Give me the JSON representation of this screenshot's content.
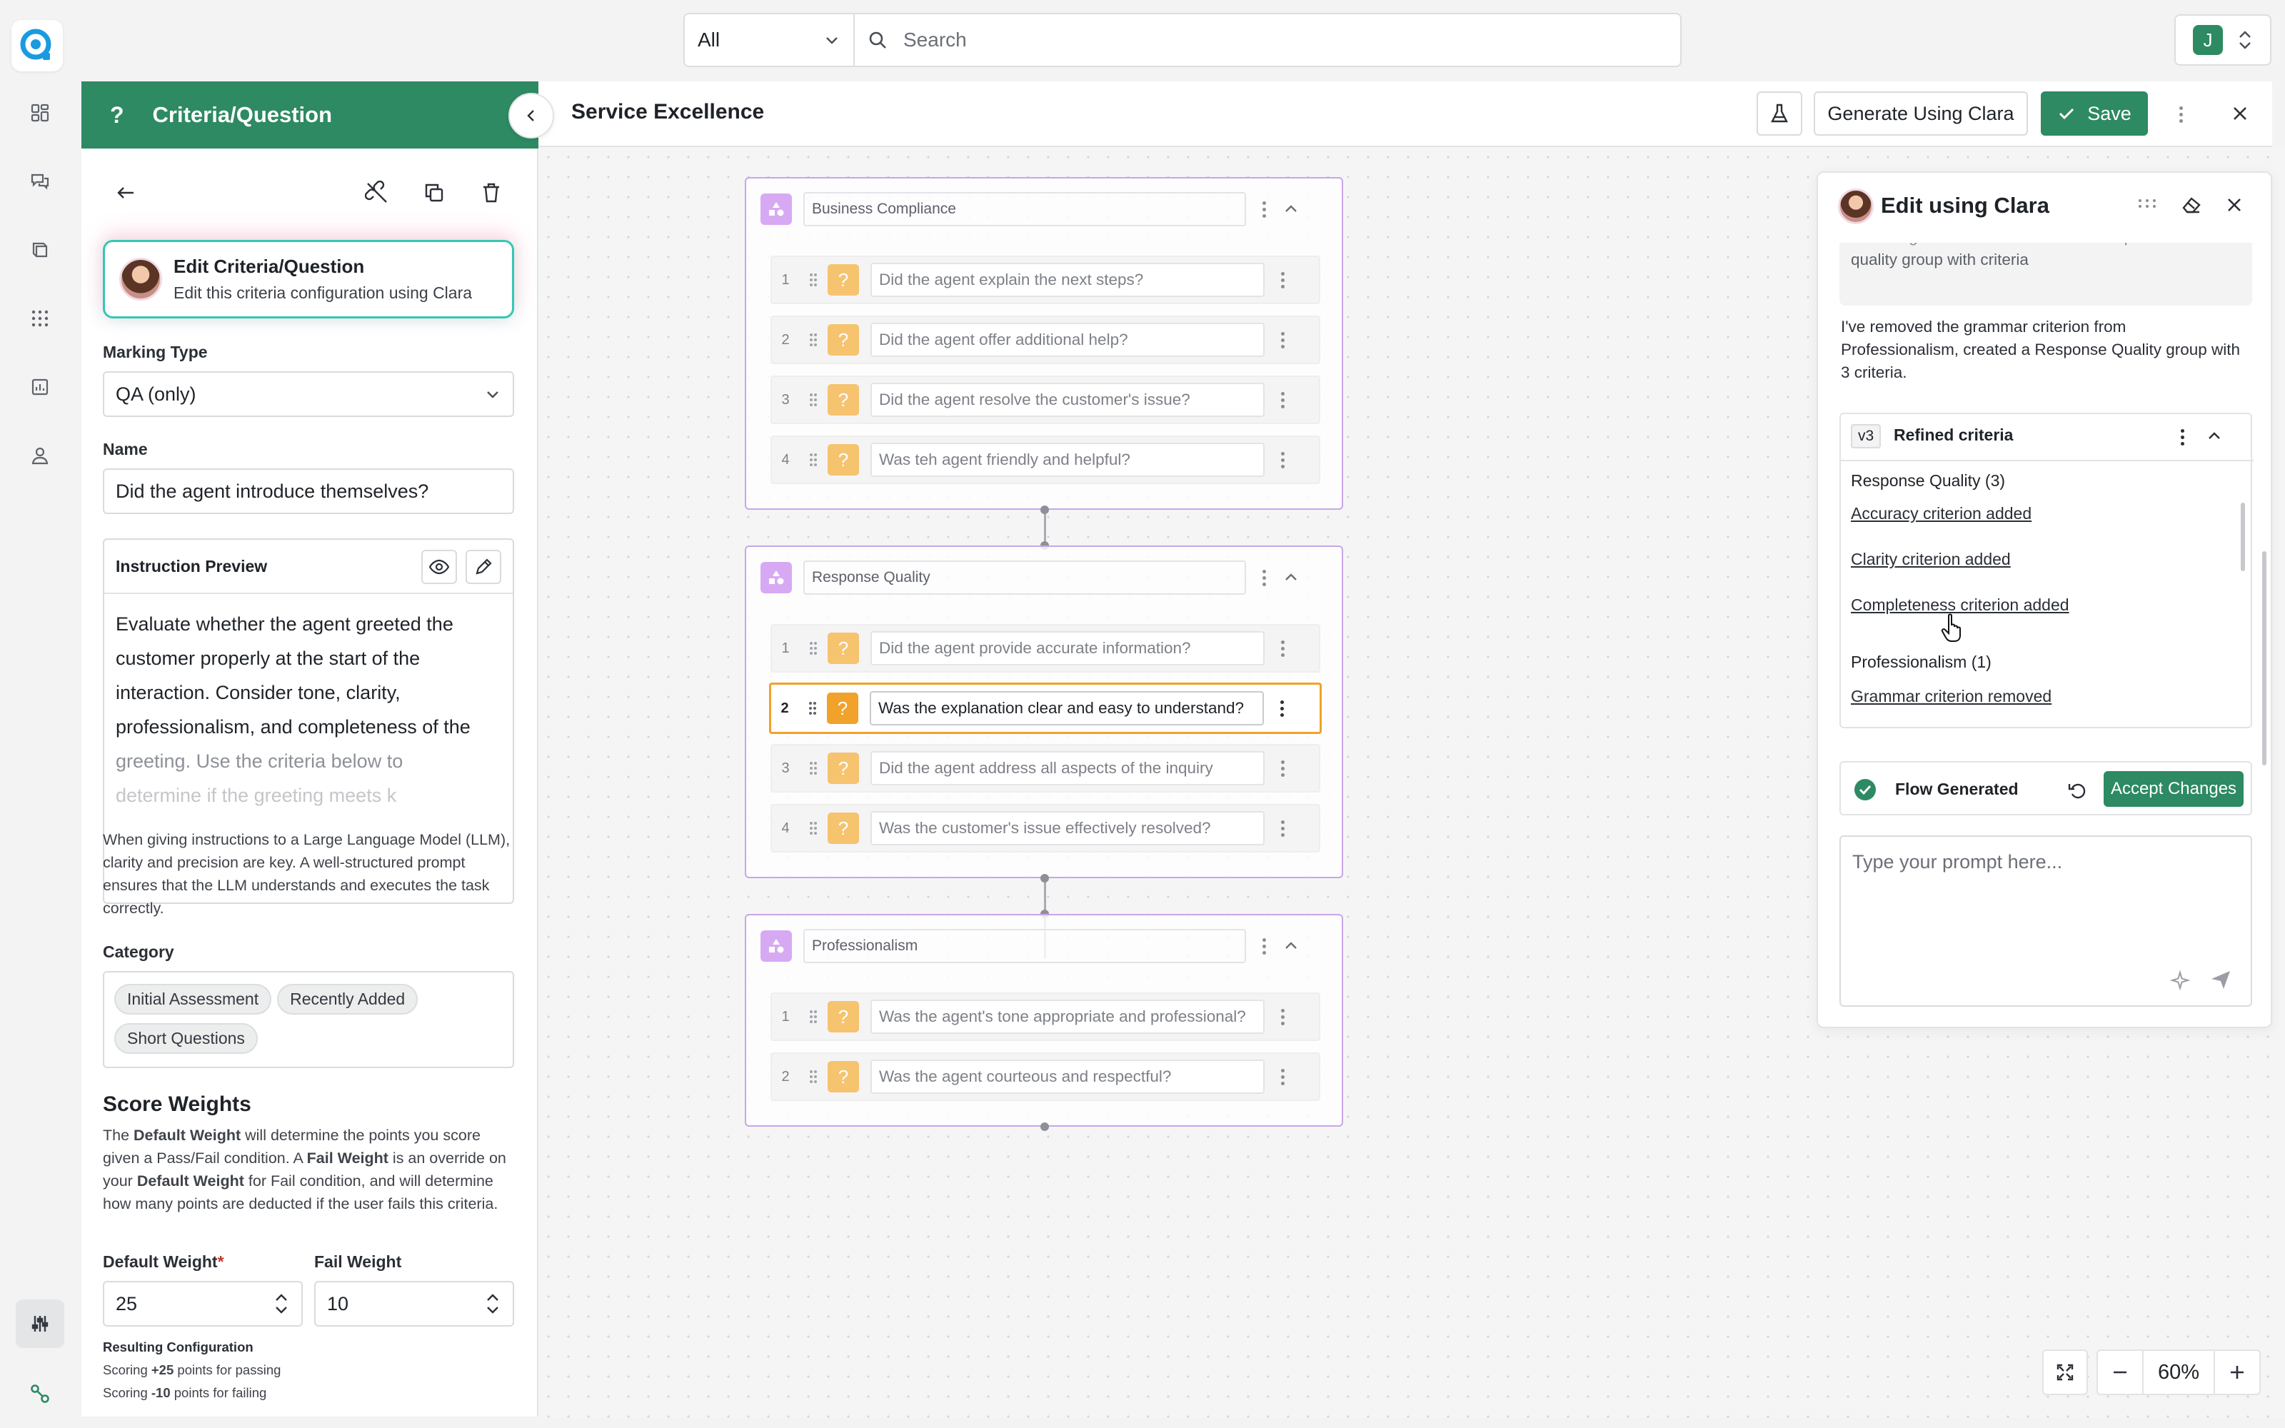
{
  "topbar": {
    "scope_select": "All",
    "search_placeholder": "Search",
    "user_initial": "J"
  },
  "criteria_panel": {
    "header_title": "Criteria/Question",
    "clara_card": {
      "title": "Edit Criteria/Question",
      "subtitle": "Edit this criteria configuration using Clara"
    },
    "marking_type_label": "Marking Type",
    "marking_type_value": "QA (only)",
    "name_label": "Name",
    "name_value": "Did the agent introduce themselves?",
    "instruction_preview_label": "Instruction Preview",
    "instruction_lines": [
      "Evaluate whether the agent greeted the",
      "customer properly at the start of the",
      "interaction. Consider tone, clarity,",
      "professionalism, and completeness of the",
      "greeting. Use the criteria below to",
      "determine if the greeting meets  k"
    ],
    "instruction_help": "When giving instructions to a Large Language Model (LLM), clarity and precision are key. A well-structured prompt ensures that the LLM understands and executes the task correctly.",
    "category_label": "Category",
    "categories": [
      "Initial Assessment",
      "Recently Added",
      "Short Questions"
    ],
    "score_weights_title": "Score Weights",
    "score_weights_desc": {
      "p1": "The ",
      "b1": "Default Weight",
      "p2": " will determine the points you score given a Pass/Fail condition. A ",
      "b2": "Fail Weight",
      "p3": " is an override on your ",
      "b3": "Default Weight",
      "p4": " for Fail condition, and will determine how many points are deducted if the user fails this criteria."
    },
    "default_weight_label": "Default Weight",
    "default_weight_required": "*",
    "default_weight_value": "25",
    "fail_weight_label": "Fail Weight",
    "fail_weight_value": "10",
    "resulting_config_title": "Resulting Configuration",
    "resulting_pass": {
      "prefix": "Scoring ",
      "value": "+25",
      "suffix": " points for passing"
    },
    "resulting_fail": {
      "prefix": "Scoring ",
      "value": "-10",
      "suffix": " points for failing"
    }
  },
  "editor": {
    "title": "Service Excellence",
    "generate_button": "Generate Using Clara",
    "save_button": "Save"
  },
  "flow": {
    "groups": [
      {
        "name": "Business Compliance",
        "questions": [
          {
            "n": "1",
            "text": "Did the agent explain the next steps?"
          },
          {
            "n": "2",
            "text": "Did the agent offer additional help?"
          },
          {
            "n": "3",
            "text": "Did the agent resolve the customer's issue?"
          },
          {
            "n": "4",
            "text": "Was teh agent friendly and helpful?"
          }
        ]
      },
      {
        "name": "Response Quality",
        "questions": [
          {
            "n": "1",
            "text": "Did the agent provide accurate information?"
          },
          {
            "n": "2",
            "text": "Was the explanation clear and easy to understand?"
          },
          {
            "n": "3",
            "text": "Did the agent address all aspects of the inquiry"
          },
          {
            "n": "4",
            "text": "Was the customer's issue effectively resolved?"
          }
        ]
      },
      {
        "name": "Professionalism",
        "questions": [
          {
            "n": "1",
            "text": "Was the agent's tone appropriate and professional?"
          },
          {
            "n": "2",
            "text": "Was the agent courteous and respectful?"
          }
        ]
      }
    ]
  },
  "clara": {
    "title": "Edit using Clara",
    "user_message_lines": [
      "remove grammar criterion and add response",
      "quality group with criteria"
    ],
    "assistant_message": "I've removed the grammar criterion from Professionalism, created a Response Quality group with 3 criteria.",
    "version_badge": "v3",
    "refined_title": "Refined criteria",
    "sections": [
      {
        "heading": "Response Quality (3)",
        "items": [
          "Accuracy criterion added",
          "Clarity criterion added",
          "Completeness criterion added"
        ]
      },
      {
        "heading": "Professionalism (1)",
        "items": [
          "Grammar criterion removed"
        ]
      }
    ],
    "flow_status": "Flow Generated",
    "accept_button": "Accept Changes",
    "prompt_placeholder": "Type your prompt here..."
  },
  "zoom": {
    "level": "60%"
  },
  "colors": {
    "brand_green": "#2d8a62",
    "group_border": "#c8a6e8",
    "question_icon": "#f6c36f",
    "active_question": "#f0a22a",
    "clara_accent": "#36c7b3"
  }
}
